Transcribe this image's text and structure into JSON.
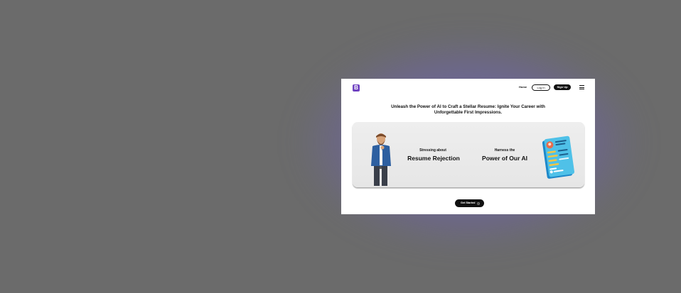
{
  "nav": {
    "logo_letter": "B",
    "home_label": "Home",
    "login_label": "Log In",
    "signup_label": "Sign Up"
  },
  "hero": {
    "headline": "Unleash the Power of AI to Craft a Stellar Resume: Ignite Your Career with Unforgettable First Impressions."
  },
  "banner": {
    "left_small": "Stressing about",
    "left_big": "Resume Rejection",
    "right_small": "Harness the",
    "right_big": "Power of Our AI"
  },
  "cta": {
    "label": "Get Started"
  },
  "colors": {
    "brand": "#6f42c1",
    "primary_button": "#111111",
    "backdrop": "#6b6b6b"
  },
  "icons": [
    "hamburger-menu-icon",
    "arrow-right-circle-icon",
    "person-illustration",
    "resume-document-illustration"
  ]
}
